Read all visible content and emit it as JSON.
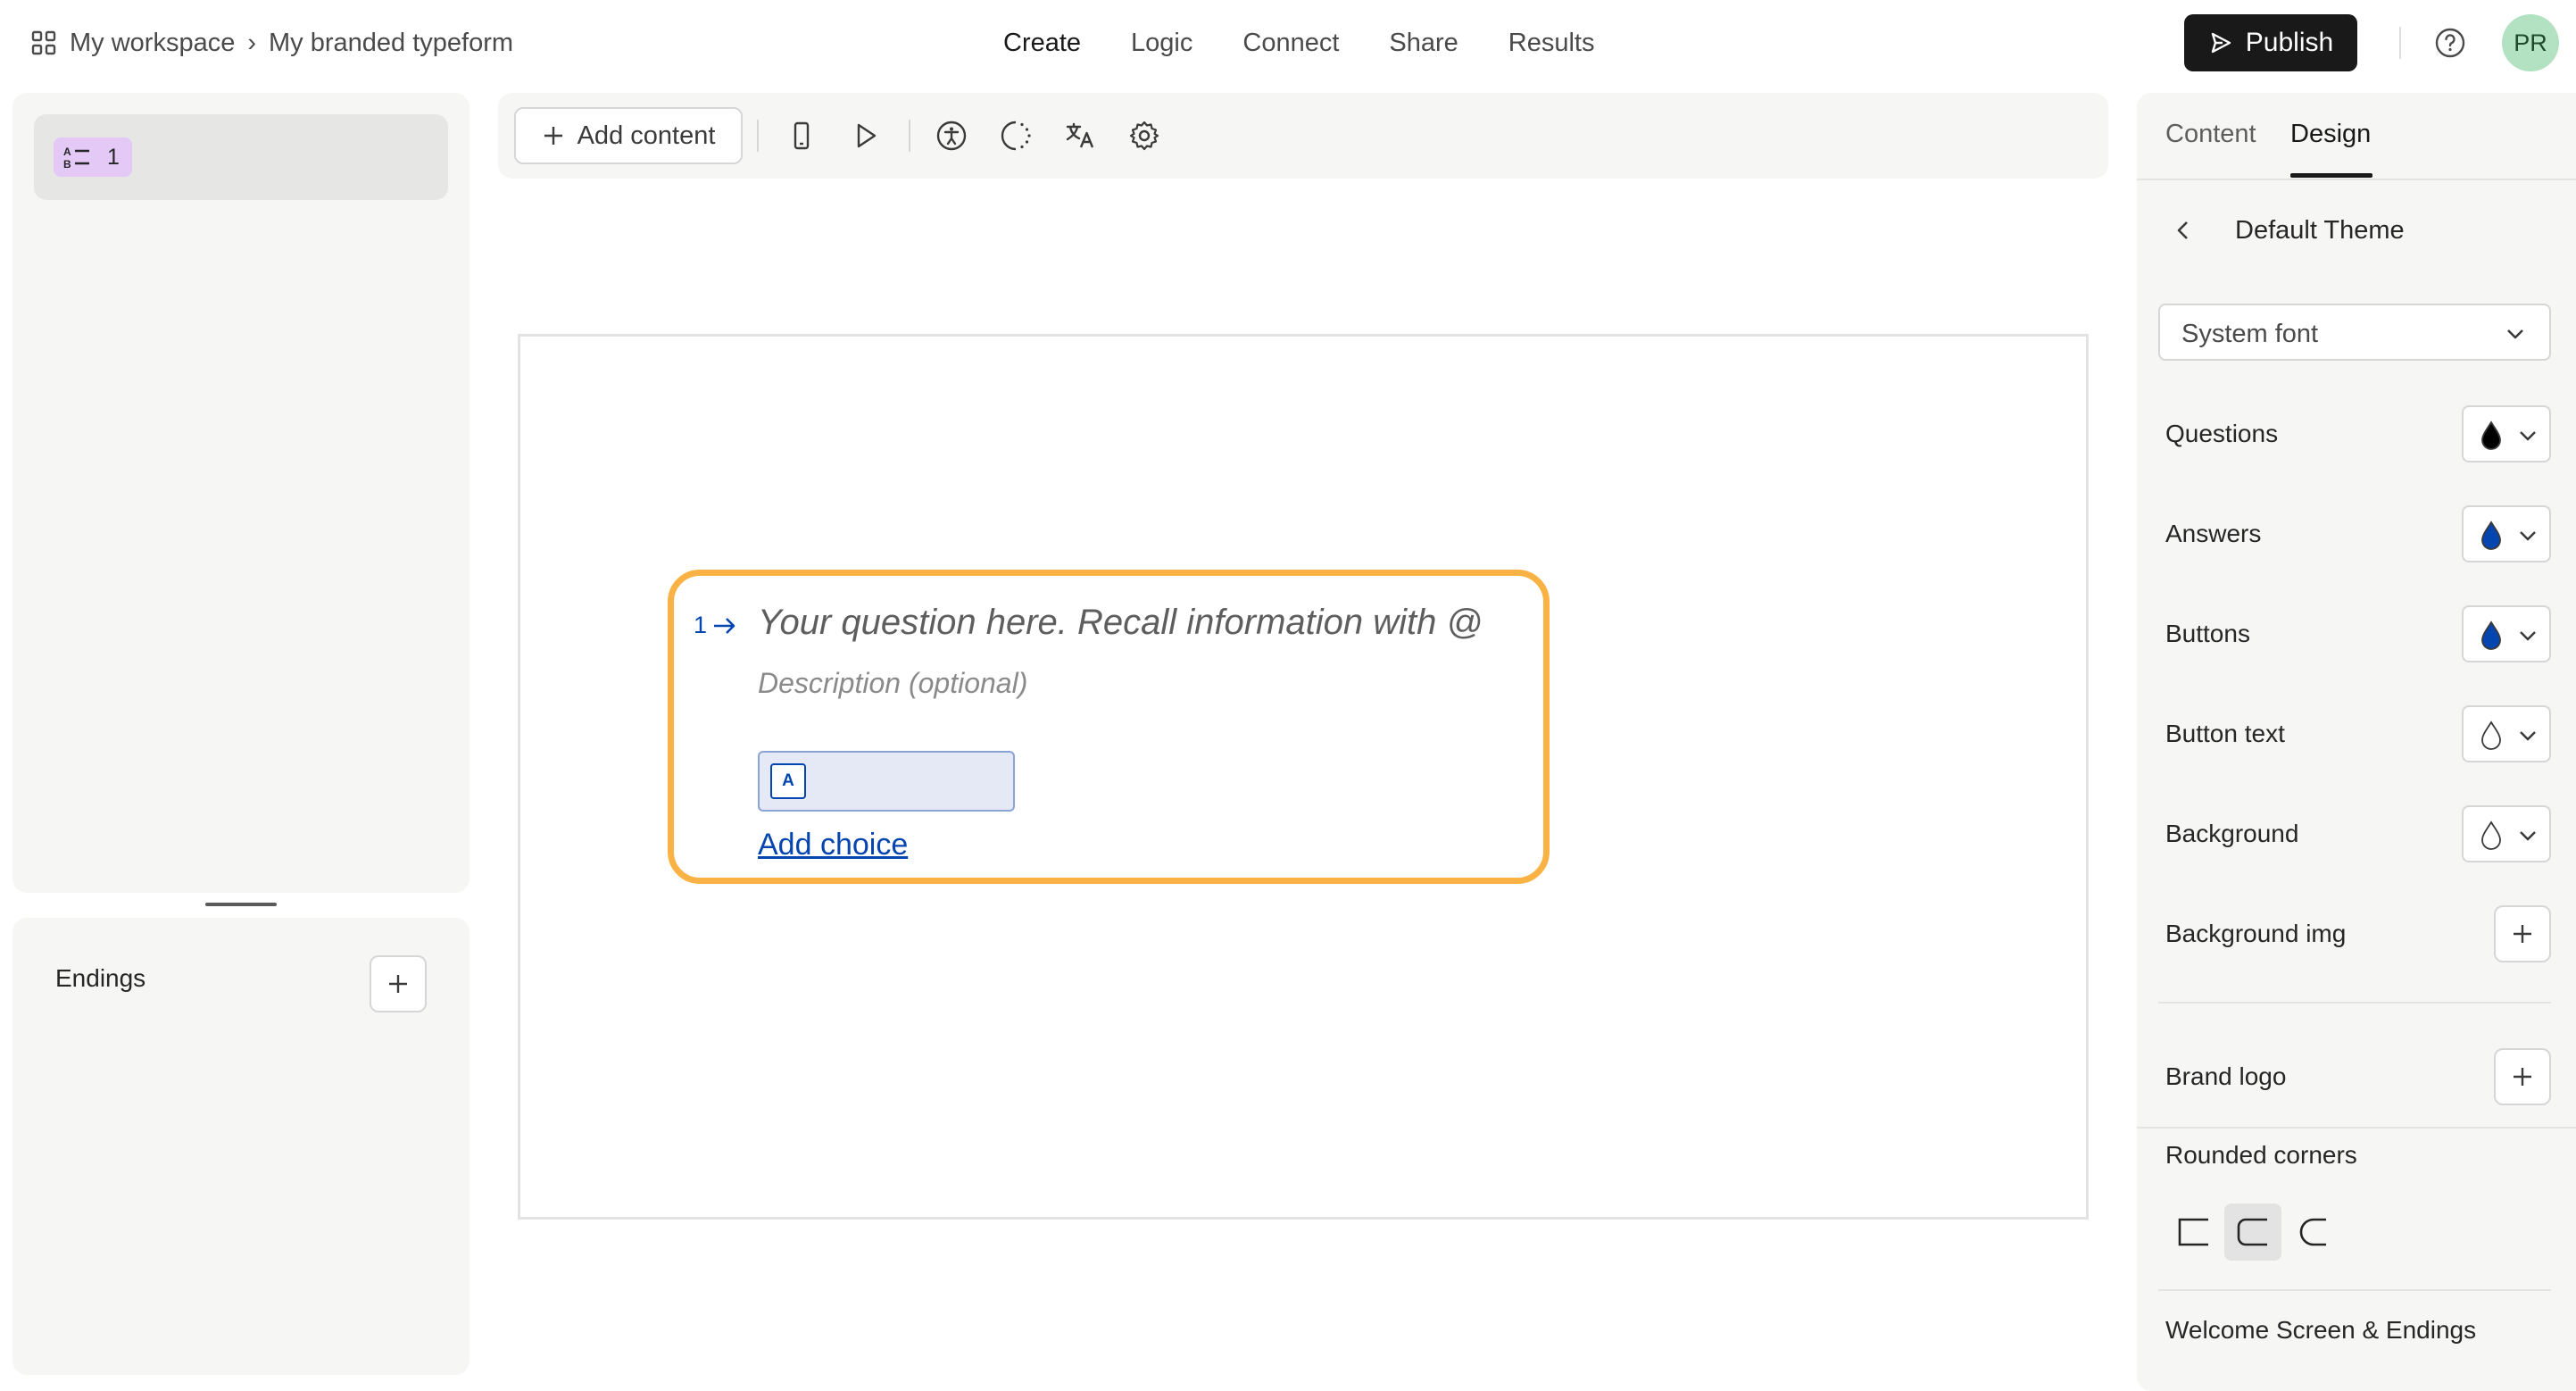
{
  "breadcrumb": {
    "workspace": "My workspace",
    "separator": "›",
    "form": "My branded typeform"
  },
  "nav": {
    "create": "Create",
    "logic": "Logic",
    "connect": "Connect",
    "share": "Share",
    "results": "Results"
  },
  "header": {
    "publish_label": "Publish",
    "avatar_initials": "PR"
  },
  "left": {
    "question_number": "1",
    "endings_label": "Endings"
  },
  "toolbar": {
    "add_content_label": "Add content",
    "tools": [
      "mobile-preview-icon",
      "play-icon",
      "accessibility-icon",
      "loading-icon",
      "translate-icon",
      "settings-icon"
    ]
  },
  "question": {
    "number": "1",
    "title": "Your question here. Recall information with @",
    "description": "Description (optional)",
    "choice_key": "A",
    "add_choice_label": "Add choice"
  },
  "design": {
    "tabs": {
      "content": "Content",
      "design": "Design",
      "active": "Design"
    },
    "theme_name": "Default Theme",
    "font": "System font",
    "colors": [
      {
        "label": "Questions",
        "color": "#000000"
      },
      {
        "label": "Answers",
        "color": "#0445af"
      },
      {
        "label": "Buttons",
        "color": "#0445af"
      },
      {
        "label": "Button text",
        "color": "#ffffff"
      },
      {
        "label": "Background",
        "color": "#ffffff"
      }
    ],
    "background_img_label": "Background img",
    "brand_logo_label": "Brand logo",
    "rounded_corners_label": "Rounded corners",
    "rounded_corners_selected": "medium",
    "welcome_label": "Welcome Screen & Endings"
  },
  "accent_color": "#f9b243"
}
